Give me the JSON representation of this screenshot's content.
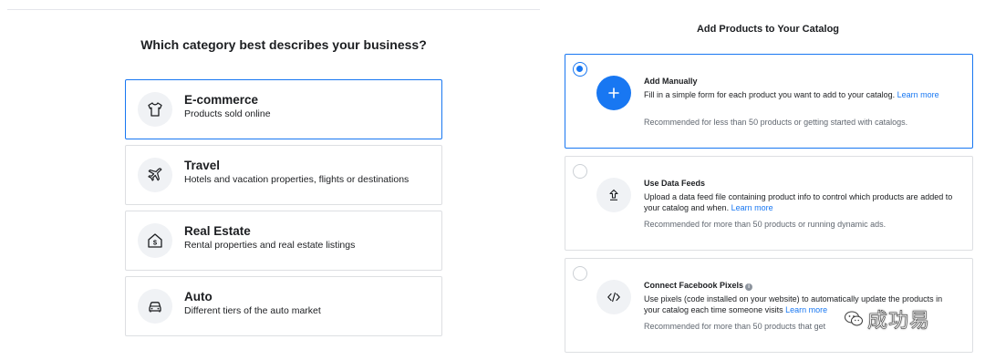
{
  "left": {
    "heading": "Which category best describes your business?",
    "categories": [
      {
        "icon": "tshirt-icon",
        "title": "E-commerce",
        "desc": "Products sold online",
        "selected": true
      },
      {
        "icon": "airplane-icon",
        "title": "Travel",
        "desc": "Hotels and vacation properties, flights or destinations",
        "selected": false
      },
      {
        "icon": "house-dollar-icon",
        "title": "Real Estate",
        "desc": "Rental properties and real estate listings",
        "selected": false
      },
      {
        "icon": "car-icon",
        "title": "Auto",
        "desc": "Different tiers of the auto market",
        "selected": false
      }
    ]
  },
  "right": {
    "heading": "Add Products to Your Catalog",
    "options": [
      {
        "icon": "plus-icon",
        "title": "Add Manually",
        "desc": "Fill in a simple form for each product you want to add to your catalog.",
        "link": "Learn more",
        "note": "Recommended for less than 50 products or getting started with catalogs.",
        "checked": true
      },
      {
        "icon": "upload-icon",
        "title": "Use Data Feeds",
        "desc": "Upload a data feed file containing product info to control which products are added to your catalog and when.",
        "link": "Learn more",
        "note": "Recommended for more than 50 products or running dynamic ads.",
        "checked": false
      },
      {
        "icon": "code-icon",
        "title": "Connect Facebook Pixels",
        "desc": "Use pixels (code installed on your website) to automatically update the products in your catalog each time someone visits",
        "link": "Learn more",
        "note": "Recommended for more than 50 products that get",
        "checked": false
      }
    ]
  },
  "watermark": {
    "text": "成功易",
    "icon": "wechat-icon"
  },
  "colors": {
    "accent": "#1877f2",
    "border": "#dddfe2",
    "icon_bg": "#f0f2f5",
    "muted": "#606770"
  }
}
